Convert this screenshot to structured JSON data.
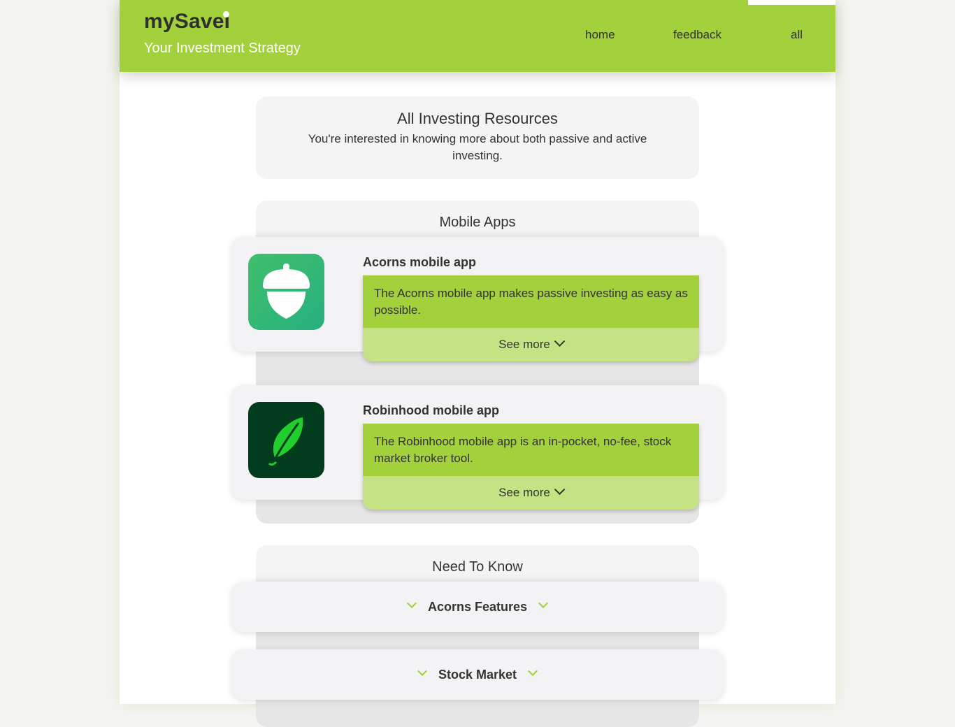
{
  "header": {
    "brand": "mySavei",
    "tagline": "Your Investment Strategy",
    "nav": [
      {
        "label": "home"
      },
      {
        "label": "feedback"
      },
      {
        "label": "all"
      }
    ],
    "accent_color": "#a3d13b"
  },
  "intro": {
    "title": "All Investing Resources",
    "text": "You're interested in knowing more about both passive and active investing."
  },
  "mobile_apps": {
    "title": "Mobile Apps",
    "apps": [
      {
        "name": "Acorns mobile app",
        "description": "The Acorns mobile app makes passive investing as easy as possible.",
        "see_more": "See more",
        "icon": "acorn-icon"
      },
      {
        "name": "Robinhood mobile app",
        "description": "The Robinhood mobile app is an in-pocket, no-fee, stock market broker tool.",
        "see_more": "See more",
        "icon": "feather-icon"
      }
    ]
  },
  "need_to_know": {
    "title": "Need To Know",
    "items": [
      {
        "label": "Acorns Features"
      },
      {
        "label": "Stock Market"
      }
    ]
  }
}
